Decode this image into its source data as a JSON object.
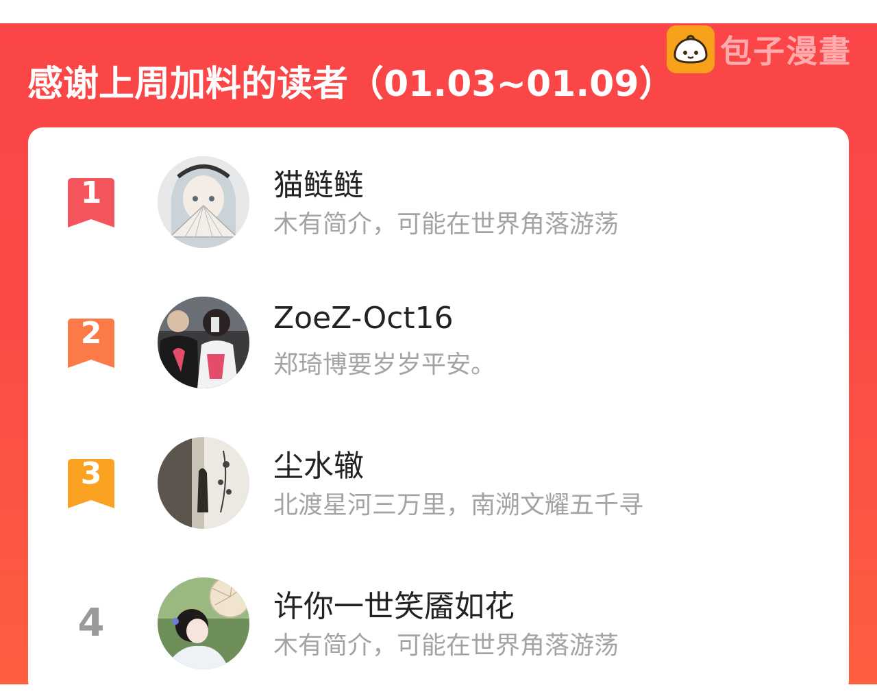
{
  "header": {
    "title": "感谢上周加料的读者（01.03~01.09）",
    "brand_name": "包子漫畫",
    "brand_color": "#f7a11b",
    "background_color": "#fb4548"
  },
  "readers": [
    {
      "rank": "1",
      "name": "猫鲢鲢",
      "bio": "木有简介，可能在世界角落游荡",
      "badge_color": "#f4555c"
    },
    {
      "rank": "2",
      "name": "ZoeZ-Oct16",
      "bio": "郑琦博要岁岁平安。",
      "badge_color": "#fb7a48"
    },
    {
      "rank": "3",
      "name": "尘水辙",
      "bio": "北渡星河三万里，南溯文耀五千寻",
      "badge_color": "#fca223"
    },
    {
      "rank": "4",
      "name": "许你一世笑靥如花",
      "bio": "木有简介，可能在世界角落游荡",
      "badge_color": ""
    }
  ]
}
